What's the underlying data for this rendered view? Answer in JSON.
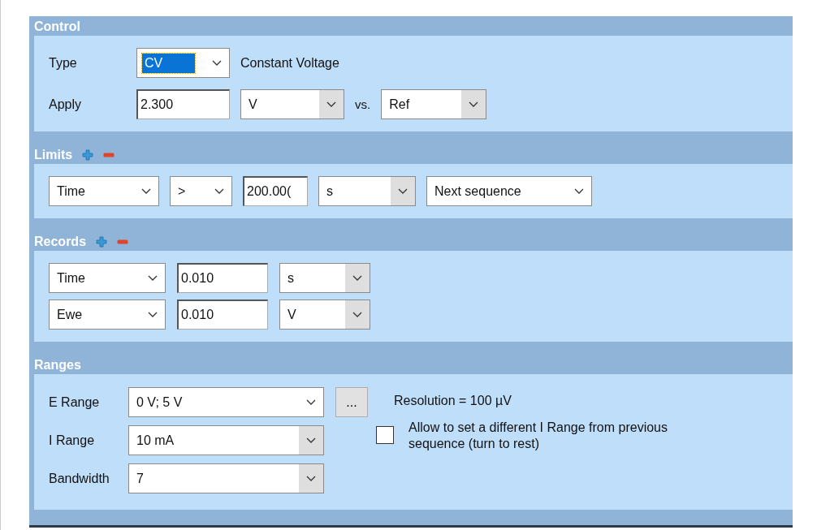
{
  "control": {
    "title": "Control",
    "type": {
      "label": "Type",
      "dropdown": {
        "value": "CV",
        "highlighted": true,
        "shaded_arrow": false
      },
      "description": "Constant Voltage"
    },
    "apply": {
      "label": "Apply",
      "value": "2.300",
      "unit": {
        "value": "V",
        "highlighted": false,
        "shaded_arrow": true
      },
      "vs_label": "vs.",
      "reference": {
        "value": "Ref",
        "highlighted": false,
        "shaded_arrow": true
      }
    }
  },
  "limits": {
    "title": "Limits",
    "row": [
      {
        "kind": "dropdown",
        "value": "Time",
        "highlighted": false,
        "shaded_arrow": false
      },
      {
        "kind": "dropdown",
        "value": ">",
        "highlighted": false,
        "shaded_arrow": false
      },
      {
        "kind": "field",
        "value": "200.00("
      },
      {
        "kind": "dropdown",
        "value": "s",
        "highlighted": false,
        "shaded_arrow": true
      },
      {
        "kind": "dropdown",
        "value": "Next sequence",
        "highlighted": false,
        "shaded_arrow": false
      }
    ]
  },
  "records": {
    "title": "Records",
    "rows": [
      {
        "quantity": {
          "value": "Time",
          "highlighted": false,
          "shaded_arrow": false
        },
        "value": "0.010",
        "unit": {
          "value": "s",
          "highlighted": false,
          "shaded_arrow": true
        }
      },
      {
        "quantity": {
          "value": "Ewe",
          "highlighted": false,
          "shaded_arrow": false
        },
        "value": "0.010",
        "unit": {
          "value": "V",
          "highlighted": false,
          "shaded_arrow": true
        }
      }
    ]
  },
  "ranges": {
    "title": "Ranges",
    "rows": [
      {
        "label": "E Range",
        "dropdown": {
          "value": "0 V; 5 V",
          "highlighted": false,
          "shaded_arrow": false
        },
        "more_button": "..."
      },
      {
        "label": "I Range",
        "dropdown": {
          "value": "10 mA",
          "highlighted": false,
          "shaded_arrow": true
        }
      },
      {
        "label": "Bandwidth",
        "dropdown": {
          "value": "7",
          "highlighted": false,
          "shaded_arrow": true
        }
      }
    ],
    "resolution": "Resolution = 100 µV",
    "allow_different_range": {
      "label": "Allow to set a different I Range from previous sequence (turn to rest)",
      "checked": false
    }
  }
}
